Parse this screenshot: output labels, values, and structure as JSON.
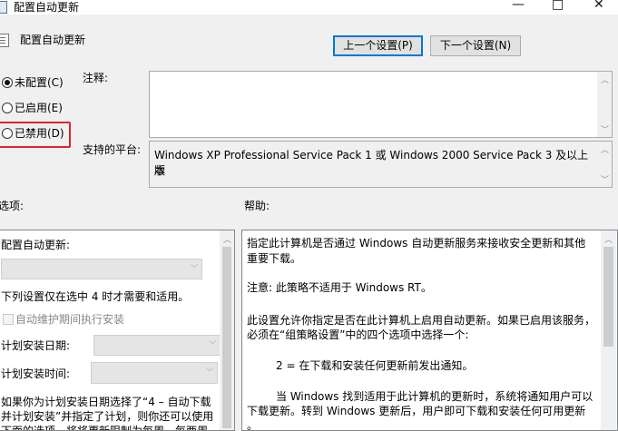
{
  "window": {
    "title": "配置自动更新",
    "minimize_icon": "—",
    "maximize_icon": "□",
    "close_icon": "✕"
  },
  "header": {
    "policy_name": "配置自动更新"
  },
  "nav": {
    "prev_label": "上一个设置(P)",
    "next_label": "下一个设置(N)"
  },
  "state": {
    "options": [
      {
        "label": "未配置(C)",
        "checked": true
      },
      {
        "label": "已启用(E)",
        "checked": false
      },
      {
        "label": "已禁用(D)",
        "checked": false
      }
    ]
  },
  "comment": {
    "label": "注释:",
    "value": ""
  },
  "platform": {
    "label": "支持的平台:",
    "line1": "Windows XP Professional Service Pack 1 或 Windows 2000 Service Pack 3 及以上版",
    "line2": "本"
  },
  "options_section": {
    "label": "选项:",
    "configure_label": "配置自动更新:",
    "note": "下列设置仅在选中 4 时才需要和适用。",
    "maintenance_checkbox": "自动维护期间执行安装",
    "schedule_day_label": "计划安装日期:",
    "schedule_time_label": "计划安装时间:",
    "footer_line1": "如果你为计划安装日期选择了“4 – 自动下载",
    "footer_line2": "并计划安装”并指定了计划，则你还可以使用",
    "footer_line3": "下面的选项，将将更新限制为每周、每两周"
  },
  "help_section": {
    "label": "帮助:",
    "p1_line1": "指定此计算机是否通过 Windows 自动更新服务来接收安全更新和其他",
    "p1_line2": "重要下载。",
    "p2": "注意: 此策略不适用于 Windows RT。",
    "p3_line1": "此设置允许你指定是否在此计算机上启用自动更新。如果已启用该服务，",
    "p3_line2": "必须在“组策略设置”中的四个选项中选择一个:",
    "p4": "2 = 在下载和安装任何更新前发出通知。",
    "p5_line1": "当 Windows 找到适用于此计算机的更新时，系统将通知用户可以",
    "p5_line2": "下载更新。转到 Windows 更新后，用户即可下载和安装任何可用更新",
    "p5_line3": "。"
  }
}
